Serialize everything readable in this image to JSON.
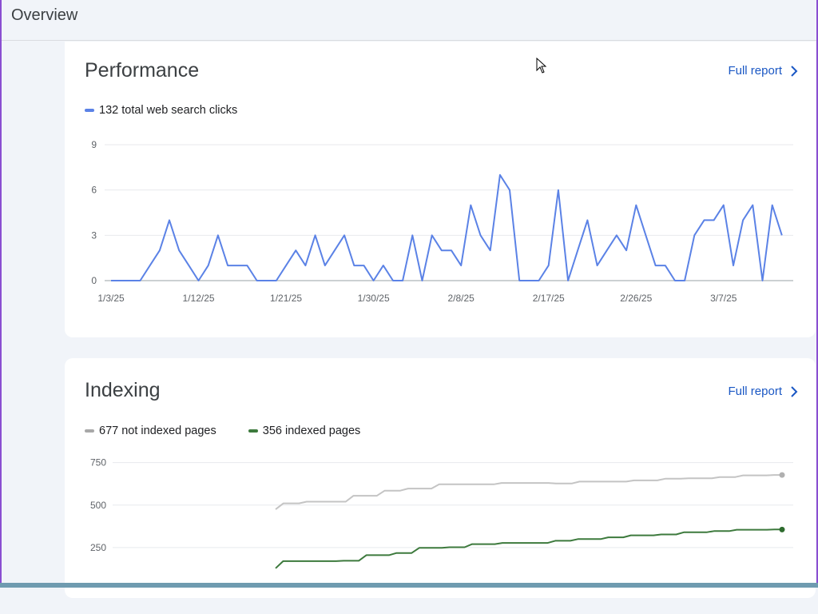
{
  "header": {
    "title": "Overview"
  },
  "performance": {
    "title": "Performance",
    "full_report_label": "Full report",
    "legend": [
      {
        "label": "132 total web search clicks",
        "color": "#5b82e6"
      }
    ],
    "chart_data": {
      "type": "line",
      "x": [
        "1/3/25",
        "1/4/25",
        "1/5/25",
        "1/6/25",
        "1/7/25",
        "1/8/25",
        "1/9/25",
        "1/10/25",
        "1/11/25",
        "1/12/25",
        "1/13/25",
        "1/14/25",
        "1/15/25",
        "1/16/25",
        "1/17/25",
        "1/18/25",
        "1/19/25",
        "1/20/25",
        "1/21/25",
        "1/22/25",
        "1/23/25",
        "1/24/25",
        "1/25/25",
        "1/26/25",
        "1/27/25",
        "1/28/25",
        "1/29/25",
        "1/30/25",
        "1/31/25",
        "2/1/25",
        "2/2/25",
        "2/3/25",
        "2/4/25",
        "2/5/25",
        "2/6/25",
        "2/7/25",
        "2/8/25",
        "2/9/25",
        "2/10/25",
        "2/11/25",
        "2/12/25",
        "2/13/25",
        "2/14/25",
        "2/15/25",
        "2/16/25",
        "2/17/25",
        "2/18/25",
        "2/19/25",
        "2/20/25",
        "2/21/25",
        "2/22/25",
        "2/23/25",
        "2/24/25",
        "2/25/25",
        "2/26/25",
        "2/27/25",
        "2/28/25",
        "3/1/25",
        "3/2/25",
        "3/3/25",
        "3/4/25",
        "3/5/25",
        "3/6/25",
        "3/7/25",
        "3/8/25",
        "3/9/25",
        "3/10/25",
        "3/11/25",
        "3/12/25",
        "3/13/25",
        "3/14/25"
      ],
      "series": [
        {
          "name": "132 total web search clicks",
          "color": "#5b82e6",
          "values": [
            0,
            0,
            0,
            0,
            1,
            2,
            4,
            2,
            1,
            0,
            1,
            3,
            1,
            1,
            1,
            0,
            0,
            0,
            1,
            2,
            1,
            3,
            1,
            2,
            3,
            1,
            1,
            0,
            1,
            0,
            0,
            3,
            0,
            3,
            2,
            2,
            1,
            5,
            3,
            2,
            7,
            6,
            0,
            0,
            0,
            1,
            6,
            0,
            2,
            4,
            1,
            2,
            3,
            2,
            5,
            3,
            1,
            1,
            0,
            0,
            3,
            4,
            4,
            5,
            1,
            4,
            5,
            0,
            5,
            3
          ]
        }
      ],
      "xticks": [
        "1/3/25",
        "1/12/25",
        "1/21/25",
        "1/30/25",
        "2/8/25",
        "2/17/25",
        "2/26/25",
        "3/7/25"
      ],
      "yticks": [
        0,
        3,
        6,
        9
      ],
      "ylim": [
        0,
        9
      ],
      "grid": true
    }
  },
  "indexing": {
    "title": "Indexing",
    "full_report_label": "Full report",
    "legend": [
      {
        "label": "677 not indexed pages",
        "color": "#a8a8a8"
      },
      {
        "label": "356 indexed pages",
        "color": "#3d7a3d"
      }
    ],
    "chart_data": {
      "type": "line",
      "yticks": [
        250,
        500,
        750
      ],
      "ylim": [
        0,
        800
      ],
      "grid": true,
      "series": [
        {
          "name": "677 not indexed pages",
          "color": "#c4c4c4",
          "values": [
            475,
            510,
            510,
            510,
            520,
            520,
            520,
            520,
            520,
            520,
            555,
            555,
            555,
            555,
            585,
            585,
            585,
            597,
            597,
            597,
            597,
            622,
            622,
            622,
            622,
            622,
            622,
            622,
            622,
            630,
            630,
            630,
            630,
            630,
            630,
            630,
            627,
            627,
            627,
            638,
            638,
            638,
            638,
            638,
            638,
            638,
            645,
            645,
            645,
            645,
            655,
            655,
            655,
            658,
            658,
            658,
            658,
            665,
            665,
            665,
            675,
            675,
            675,
            675,
            677,
            677
          ]
        },
        {
          "name": "356 indexed pages",
          "color": "#3d7a3d",
          "values": [
            128,
            170,
            170,
            170,
            170,
            170,
            170,
            170,
            170,
            172,
            172,
            172,
            205,
            205,
            205,
            205,
            218,
            218,
            218,
            248,
            248,
            248,
            248,
            252,
            252,
            252,
            270,
            270,
            270,
            270,
            277,
            277,
            277,
            277,
            277,
            277,
            277,
            290,
            290,
            290,
            300,
            300,
            300,
            300,
            310,
            310,
            310,
            322,
            322,
            322,
            322,
            327,
            327,
            327,
            340,
            340,
            340,
            340,
            347,
            347,
            347,
            355,
            355,
            355,
            355,
            355,
            356,
            356
          ]
        }
      ]
    }
  }
}
